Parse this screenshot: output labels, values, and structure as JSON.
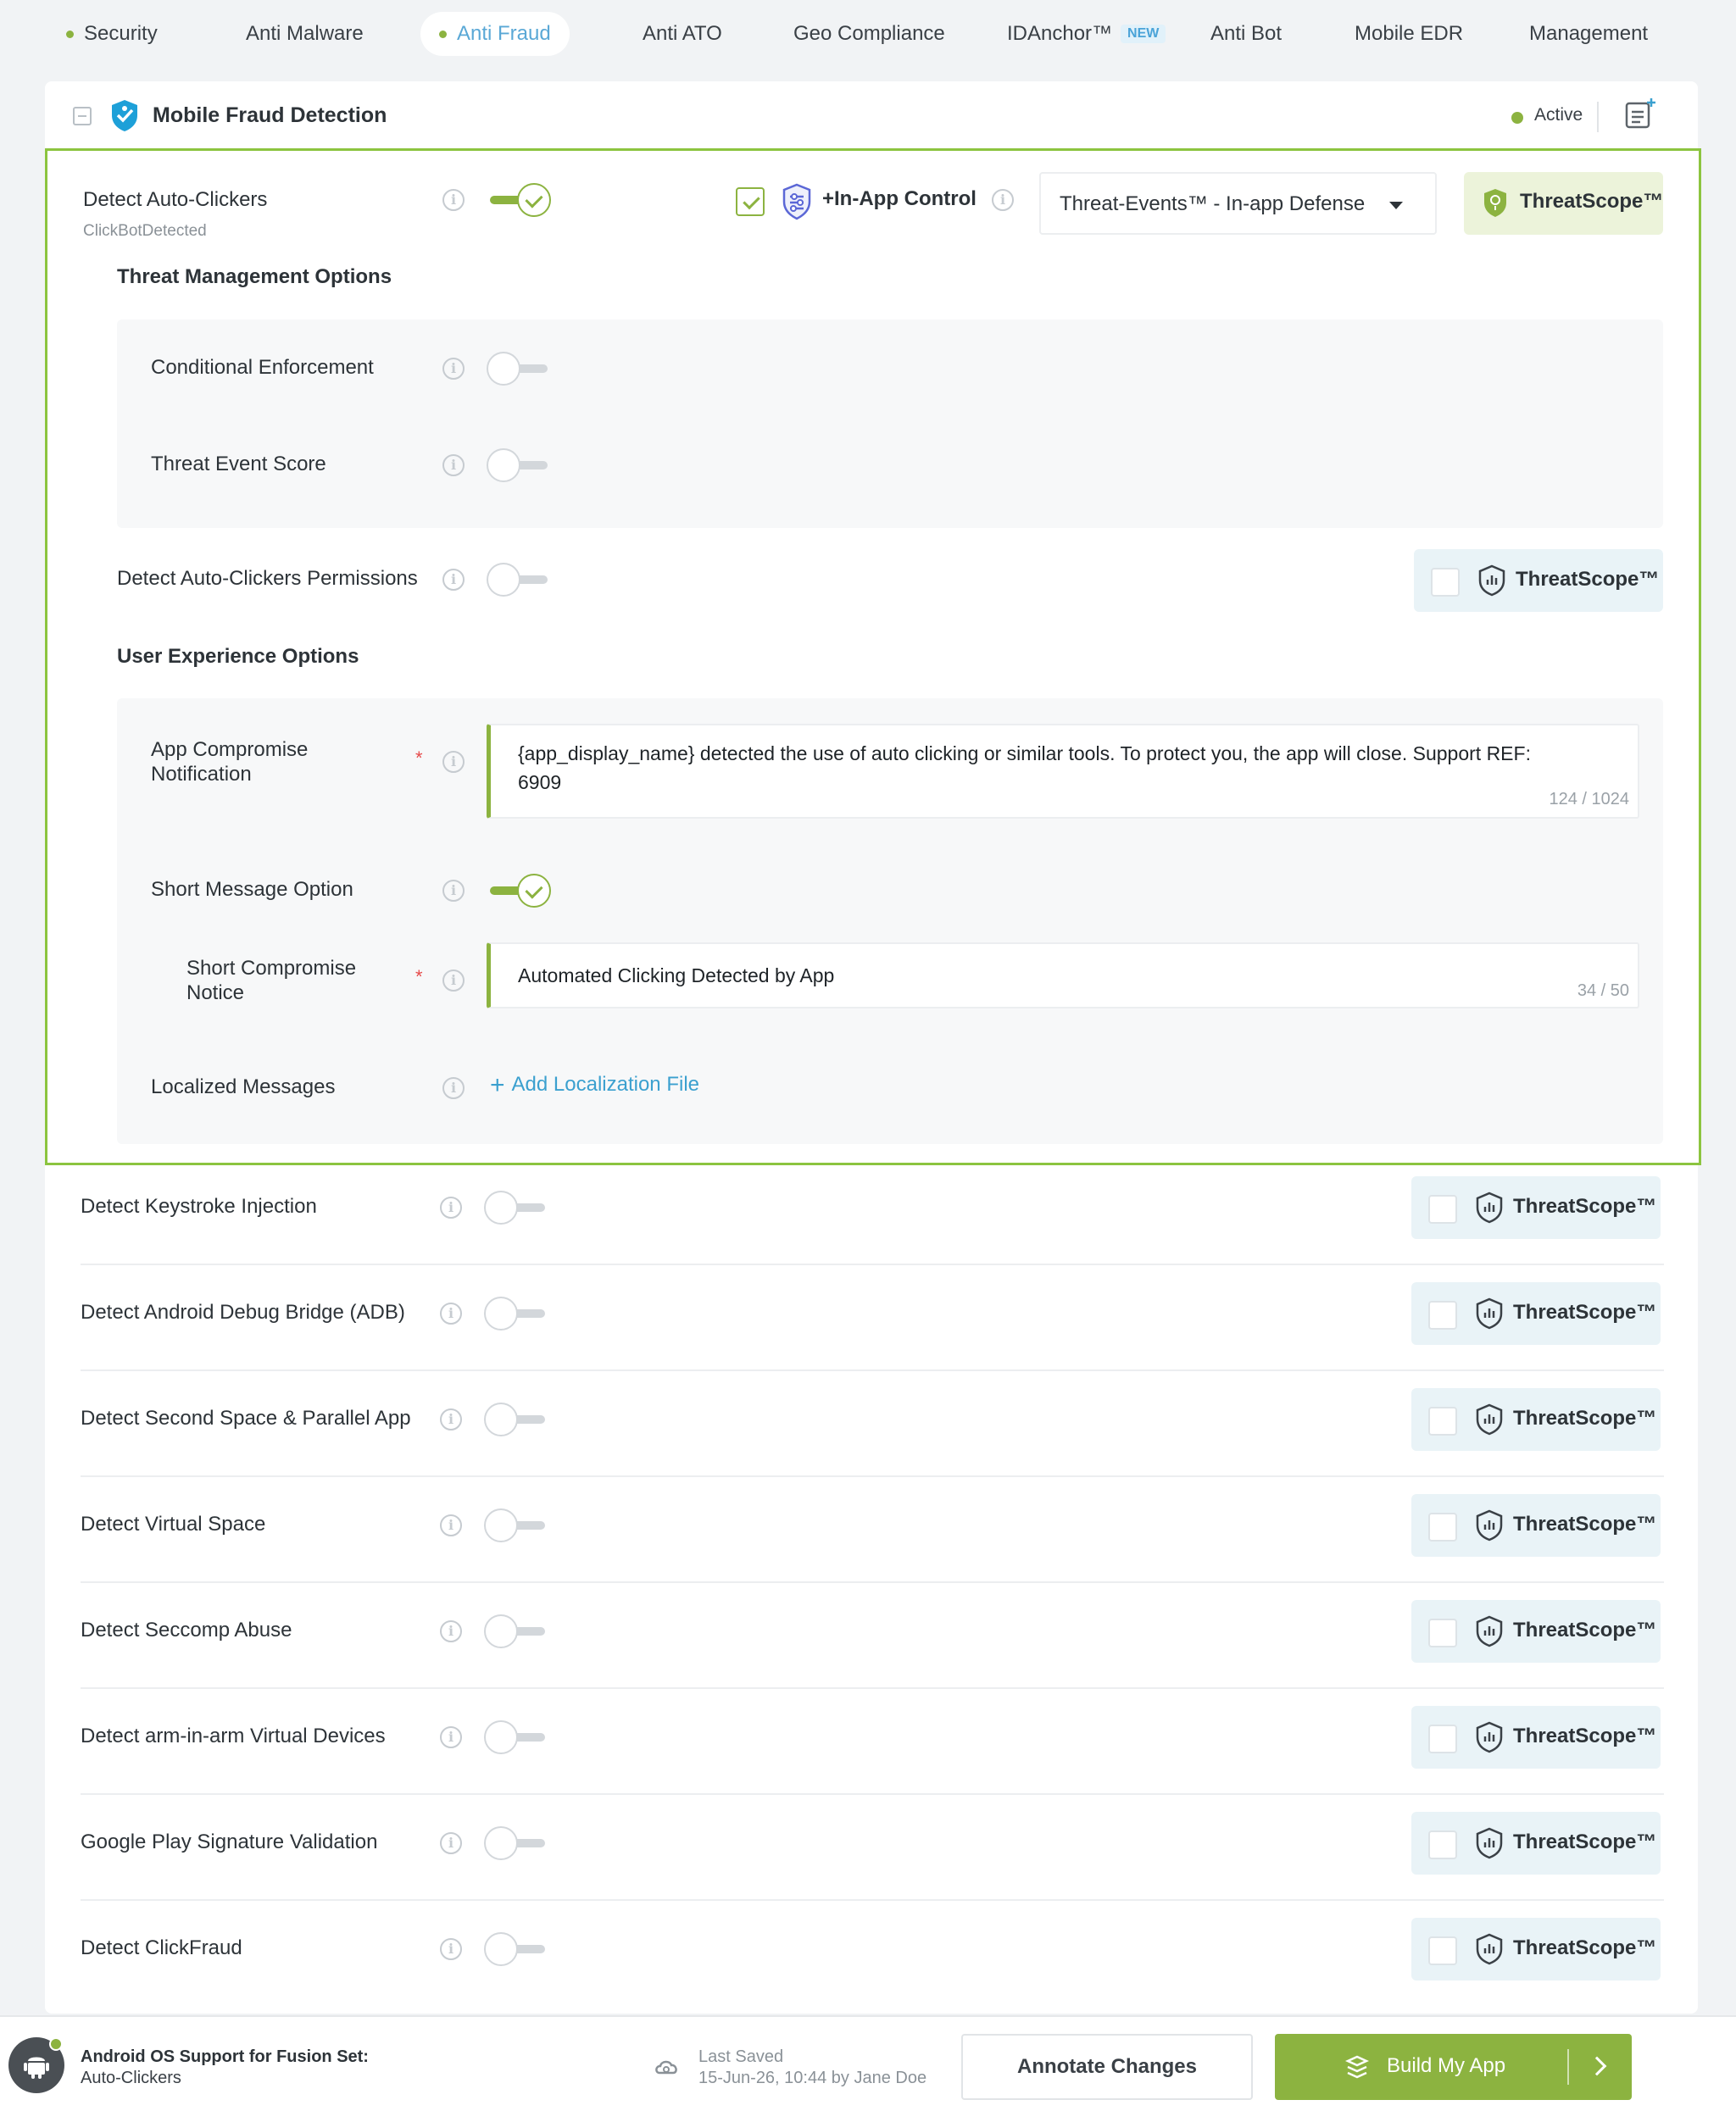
{
  "nav": {
    "tabs": [
      {
        "label": "Security"
      },
      {
        "label": "Anti Malware"
      },
      {
        "label": "Anti Fraud"
      },
      {
        "label": "Anti ATO"
      },
      {
        "label": "Geo Compliance"
      },
      {
        "label": "IDAnchor™",
        "badge": "NEW"
      },
      {
        "label": "Anti Bot"
      },
      {
        "label": "Mobile EDR"
      },
      {
        "label": "Management"
      }
    ],
    "active_tab": "Anti Fraud"
  },
  "card": {
    "title": "Mobile Fraud Detection",
    "status": "Active"
  },
  "expanded": {
    "title": "Detect Auto-Clickers",
    "subtitle": "ClickBotDetected",
    "enabled": true,
    "in_app_control": {
      "label": "+In-App Control",
      "checked": true
    },
    "defense_select": "Threat-Events™ - In-app Defense",
    "threatscope": "ThreatScope™",
    "threat_mgmt": {
      "heading": "Threat Management Options",
      "conditional_enforcement": "Conditional Enforcement",
      "threat_event_score": "Threat Event Score"
    },
    "permissions": {
      "label": "Detect Auto-Clickers Permissions",
      "threatscope": "ThreatScope™"
    },
    "ux": {
      "heading": "User Experience Options",
      "compromise_label": "App Compromise Notification",
      "compromise_text_line1": "{app_display_name} detected the use of auto clicking or similar tools. To protect you, the app will close. Support REF:",
      "compromise_text_line2": "6909",
      "compromise_count": "124 / 1024",
      "short_option_label": "Short Message Option",
      "short_notice_label": "Short Compromise Notice",
      "short_notice_text": "Automated Clicking Detected by App",
      "short_notice_count": "34 / 50",
      "localized_label": "Localized Messages",
      "add_localization": "Add Localization File"
    },
    "required_mark": "*"
  },
  "rows": [
    {
      "label": "Detect Keystroke Injection",
      "threatscope": "ThreatScope™"
    },
    {
      "label": "Detect Android Debug Bridge (ADB)",
      "threatscope": "ThreatScope™"
    },
    {
      "label": "Detect Second Space & Parallel App",
      "threatscope": "ThreatScope™"
    },
    {
      "label": "Detect Virtual Space",
      "threatscope": "ThreatScope™"
    },
    {
      "label": "Detect Seccomp Abuse",
      "threatscope": "ThreatScope™"
    },
    {
      "label": "Detect arm-in-arm Virtual Devices",
      "threatscope": "ThreatScope™"
    },
    {
      "label": "Google Play Signature Validation",
      "threatscope": "ThreatScope™"
    },
    {
      "label": "Detect ClickFraud",
      "threatscope": "ThreatScope™"
    }
  ],
  "footer": {
    "title": "Android OS Support for Fusion Set:",
    "subtitle": "Auto-Clickers",
    "saved_label": "Last Saved",
    "saved_value": "15-Jun-26, 10:44 by Jane Doe",
    "annotate": "Annotate Changes",
    "build": "Build My App"
  },
  "colors": {
    "accent_green": "#8cb340",
    "active_tab_text": "#5aa8d6",
    "link_blue": "#3ba0cf",
    "required_red": "#e64b4b"
  },
  "icons": [
    "shield-logo-icon",
    "info-icon",
    "note-add-icon",
    "shield-threatscope-icon",
    "sliders-shield-icon",
    "plus-icon",
    "android-icon",
    "cloud-saved-icon",
    "build-icon",
    "chevron-right-icon"
  ]
}
